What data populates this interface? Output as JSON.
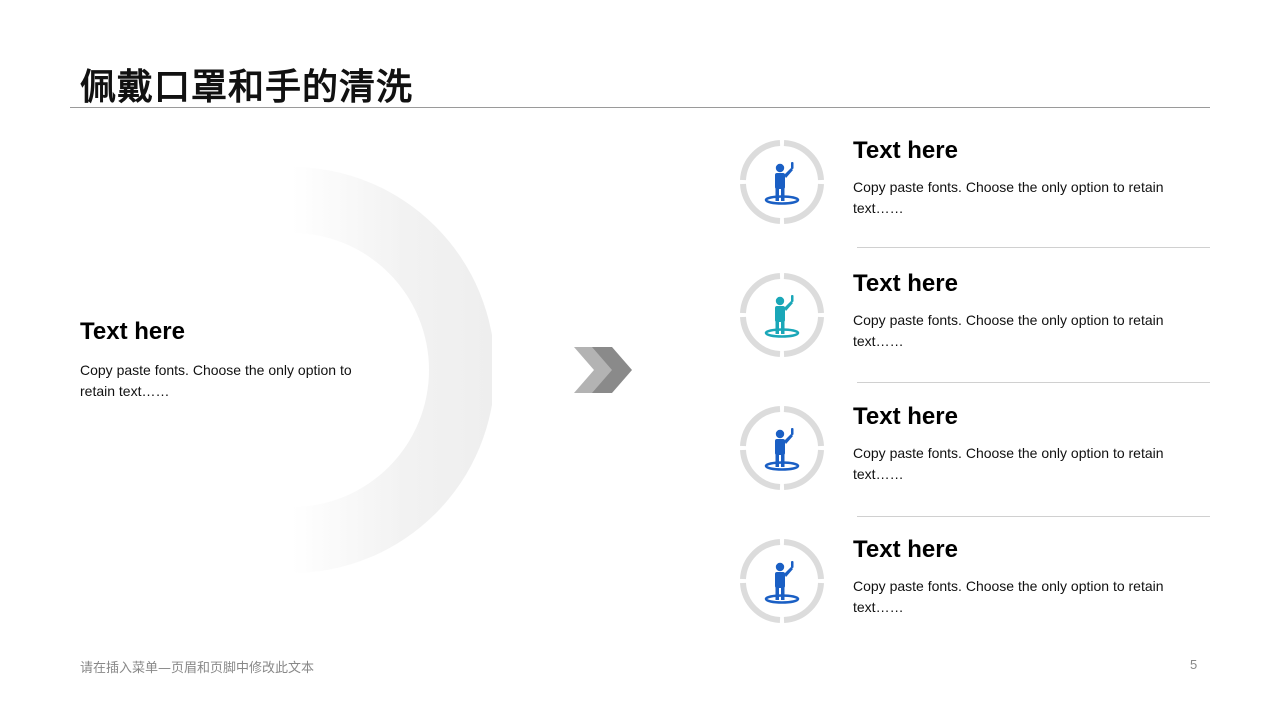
{
  "title": "佩戴口罩和手的清洗",
  "left": {
    "heading": "Text here",
    "desc": "Copy paste fonts. Choose the only option to retain text……"
  },
  "items": [
    {
      "heading": "Text here",
      "desc": "Copy paste fonts. Choose the only option to retain text……",
      "icon": "person-icon",
      "icon_color": "#1a5fc4"
    },
    {
      "heading": "Text here",
      "desc": "Copy paste fonts. Choose the only option to retain text……",
      "icon": "person-icon",
      "icon_color": "#1aa7b8"
    },
    {
      "heading": "Text here",
      "desc": "Copy paste fonts. Choose the only option to retain text……",
      "icon": "person-icon",
      "icon_color": "#1a5fc4"
    },
    {
      "heading": "Text here",
      "desc": "Copy paste fonts. Choose the only option to retain text……",
      "icon": "person-icon",
      "icon_color": "#1a5fc4"
    }
  ],
  "footer": {
    "text": "请在插入菜单—页眉和页脚中修改此文本",
    "page": "5"
  },
  "colors": {
    "ring": "#dcdcdc",
    "arc": "#f1f1f1",
    "chevron": "#8a8a8a"
  }
}
